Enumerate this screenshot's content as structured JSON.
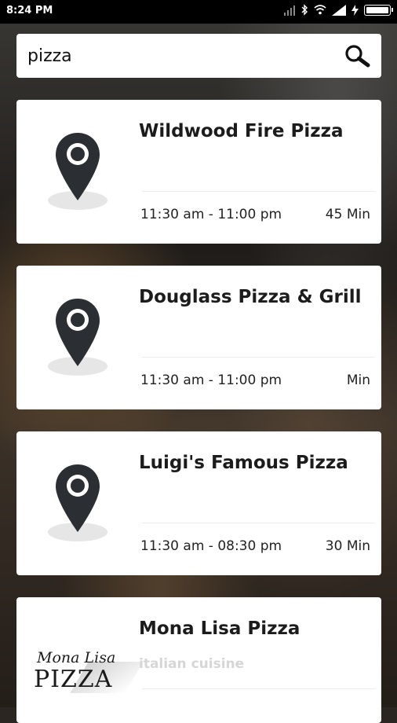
{
  "status_bar": {
    "time": "8:24 PM",
    "icons": [
      "signal-bars-icon",
      "bluetooth-icon",
      "wifi-icon",
      "cell-signal-icon",
      "charging-bolt-icon",
      "battery-icon"
    ]
  },
  "search": {
    "value": "pizza",
    "button_icon": "search-icon"
  },
  "results": [
    {
      "name": "Wildwood Fire Pizza",
      "subtitle": "",
      "hours": "11:30 am - 11:00 pm",
      "eta": "45 Min",
      "image": "location-pin-icon"
    },
    {
      "name": "Douglass Pizza & Grill",
      "subtitle": "",
      "hours": "11:30 am - 11:00 pm",
      "eta": "Min",
      "image": "location-pin-icon"
    },
    {
      "name": "Luigi's Famous Pizza",
      "subtitle": "",
      "hours": "11:30 am - 08:30 pm",
      "eta": "30 Min",
      "image": "location-pin-icon"
    },
    {
      "name": "Mona Lisa Pizza",
      "subtitle": "italian cuisine",
      "hours": "",
      "eta": "",
      "image": "restaurant-logo",
      "logo_text": [
        "Mona Lisa",
        "PIZZA"
      ]
    }
  ],
  "colors": {
    "pin": "#2b2f33",
    "pin_shadow": "#e6e6e6",
    "card": "#ffffff",
    "subtitle": "#d6d6d6"
  }
}
